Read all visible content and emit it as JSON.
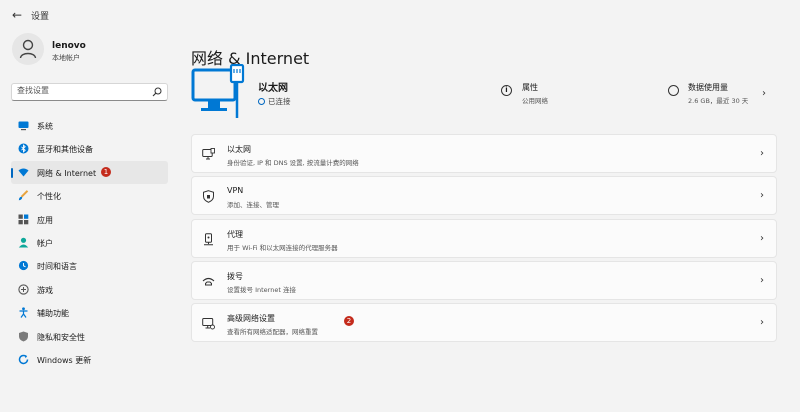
{
  "window": {
    "title": "设置"
  },
  "profile": {
    "name": "lenovo",
    "account_type": "本地帐户"
  },
  "search": {
    "placeholder": "查找设置"
  },
  "nav": {
    "items": [
      {
        "label": "系统"
      },
      {
        "label": "蓝牙和其他设备"
      },
      {
        "label": "网络 & Internet",
        "badge": "1"
      },
      {
        "label": "个性化"
      },
      {
        "label": "应用"
      },
      {
        "label": "帐户"
      },
      {
        "label": "时间和语言"
      },
      {
        "label": "游戏"
      },
      {
        "label": "辅助功能"
      },
      {
        "label": "隐私和安全性"
      },
      {
        "label": "Windows 更新"
      }
    ]
  },
  "main": {
    "title": "网络 & Internet",
    "hero": {
      "name": "以太网",
      "status": "已连接",
      "properties": {
        "title": "属性",
        "sub": "公用网络"
      },
      "data_usage": {
        "title": "数据使用量",
        "sub": "2.6 GB，最近 30 天"
      }
    },
    "cards": [
      {
        "title": "以太网",
        "sub": "身份验证, IP 和 DNS 设置, 按流量计费的网络"
      },
      {
        "title": "VPN",
        "sub": "添加、连接、管理"
      },
      {
        "title": "代理",
        "sub": "用于 Wi-Fi 和以太网连接的代理服务器"
      },
      {
        "title": "拨号",
        "sub": "设置拨号 Internet 连接"
      },
      {
        "title": "高级网络设置",
        "sub": "查看所有网络适配器，网络重置",
        "badge": "2"
      }
    ]
  },
  "colors": {
    "accent": "#0067c0",
    "badge": "#c42b1c"
  }
}
